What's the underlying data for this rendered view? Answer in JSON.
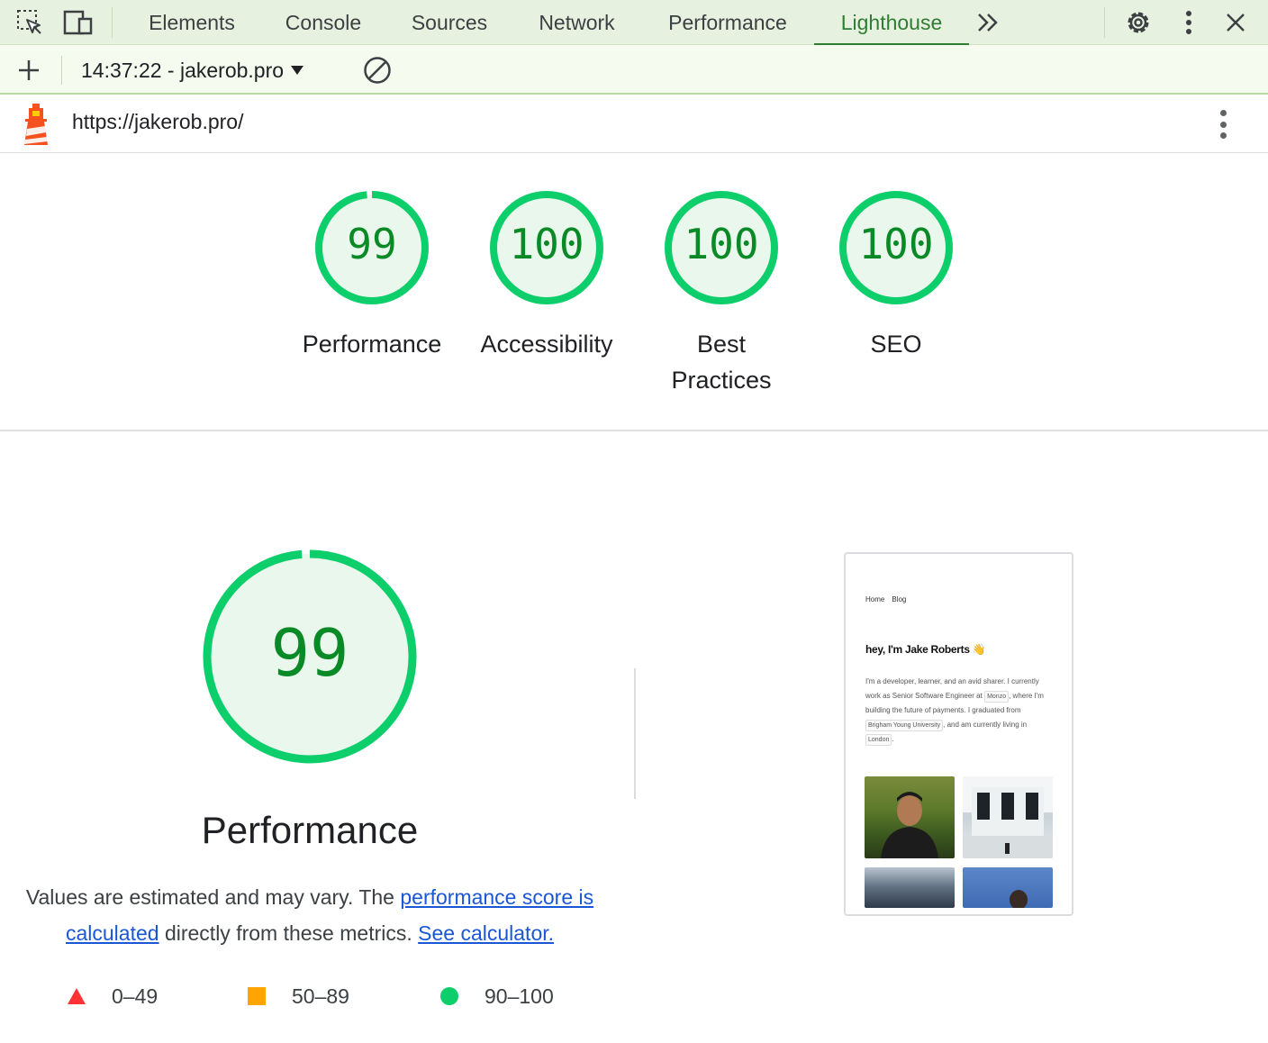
{
  "devtools": {
    "tabs": [
      "Elements",
      "Console",
      "Sources",
      "Network",
      "Performance",
      "Lighthouse"
    ],
    "active_tab": "Lighthouse",
    "overflow_icon": "chevron-double-right-icon",
    "settings_icon": "gear-icon",
    "more_icon": "vertical-dots-icon",
    "close_icon": "close-icon"
  },
  "lighthouse_toolbar": {
    "report_select": "14:37:22 - jakerob.pro",
    "add_icon": "plus-icon",
    "clear_icon": "block-icon"
  },
  "report": {
    "url": "https://jakerob.pro/",
    "logo_icon": "lighthouse-icon"
  },
  "categories": [
    {
      "label": "Performance",
      "score": "99",
      "value": 99
    },
    {
      "label": "Accessibility",
      "score": "100",
      "value": 100
    },
    {
      "label": "Best Practices",
      "score": "100",
      "value": 100
    },
    {
      "label": "SEO",
      "score": "100",
      "value": 100
    }
  ],
  "performance": {
    "score": "99",
    "value": 99,
    "title": "Performance",
    "desc_prefix": "Values are estimated and may vary. The ",
    "link1": "performance score is calculated",
    "desc_middle": " directly from these metrics. ",
    "link2": "See calculator."
  },
  "legend": [
    {
      "range": "0–49",
      "shape": "triangle",
      "color": "#ff3333"
    },
    {
      "range": "50–89",
      "shape": "square",
      "color": "#ffa400"
    },
    {
      "range": "90–100",
      "shape": "circle",
      "color": "#0cce6b"
    }
  ],
  "colors": {
    "pass": "#0cce6b",
    "pass_text": "#0a8a27",
    "pass_fill": "#e9f7ec"
  },
  "screenshot": {
    "nav": [
      "Home",
      "Blog"
    ],
    "heading": "hey, I'm Jake Roberts 👋",
    "bio_1": "I'm a developer, learner, and an avid sharer. I currently work as Senior Software Engineer at",
    "pill_company": "Monzo",
    "bio_2": ", where I'm building the future of payments. I graduated from",
    "pill_school": "Brigham Young University",
    "bio_3": ", and am currently living in",
    "pill_city": "London",
    "bio_4": "."
  }
}
